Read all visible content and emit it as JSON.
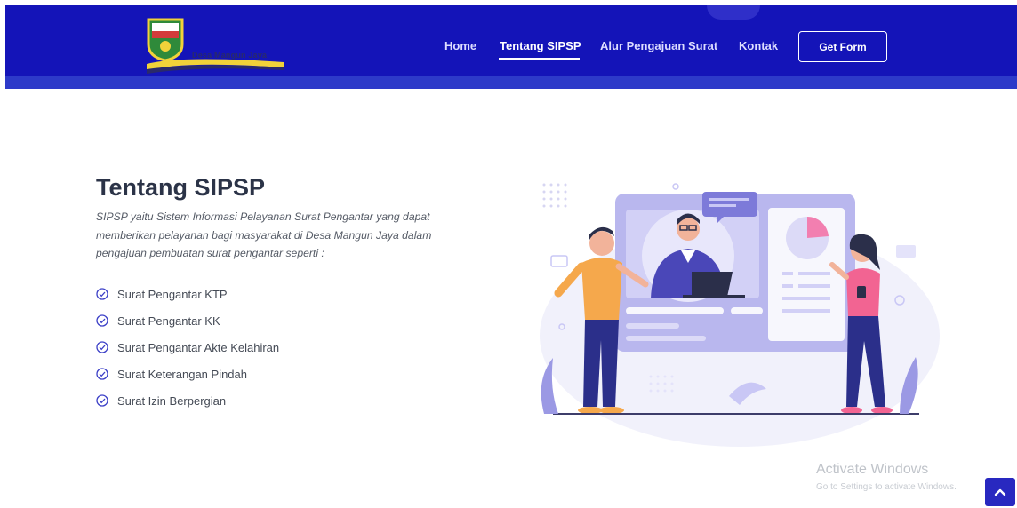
{
  "header": {
    "logo_text": "Desa Mangun Jaya",
    "nav": [
      {
        "label": "Home",
        "active": false
      },
      {
        "label": "Tentang SIPSP",
        "active": true
      },
      {
        "label": "Alur Pengajuan Surat",
        "active": false
      },
      {
        "label": "Kontak",
        "active": false
      }
    ],
    "cta_label": "Get Form"
  },
  "about": {
    "title": "Tentang SIPSP",
    "description": "SIPSP yaitu Sistem Informasi Pelayanan Surat Pengantar yang dapat memberikan pelayanan bagi masyarakat di Desa Mangun Jaya dalam pengajuan pembuatan surat pengantar seperti :",
    "items": [
      "Surat Pengantar KTP",
      "Surat Pengantar KK",
      "Surat Pengantar Akte Kelahiran",
      "Surat Keterangan Pindah",
      "Surat Izin Berpergian"
    ]
  },
  "watermark": {
    "title": "Activate Windows",
    "subtitle": "Go to Settings to activate Windows."
  },
  "colors": {
    "header": "#1414b8",
    "accent": "#2828c0",
    "illustration": "#b9b7ee"
  },
  "icons": {
    "list_item": "check-circle-icon",
    "scroll_top": "chevron-up-icon"
  }
}
